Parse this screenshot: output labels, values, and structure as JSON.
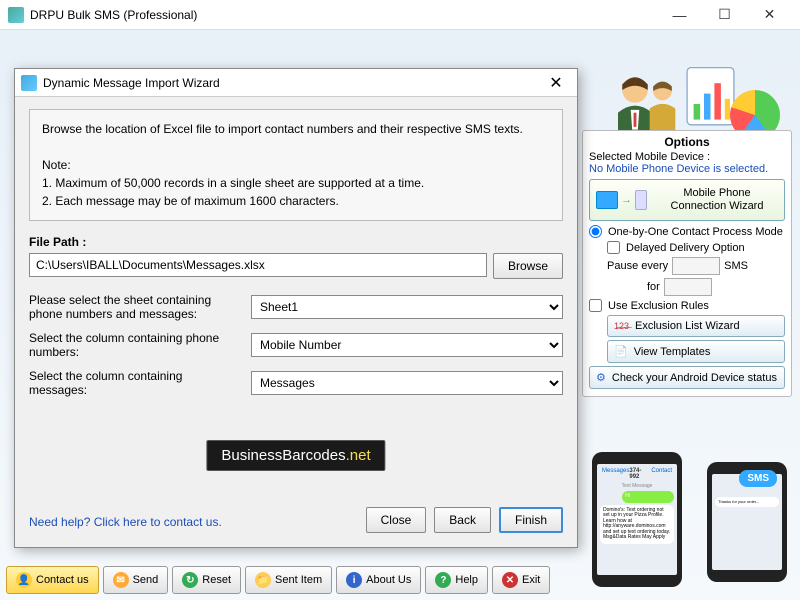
{
  "window": {
    "title": "DRPU Bulk SMS (Professional)"
  },
  "dialog": {
    "title": "Dynamic Message Import Wizard",
    "intro": "Browse the location of Excel file to import contact numbers and their respective SMS texts.",
    "note_label": "Note:",
    "note1": "1. Maximum of 50,000 records in a single sheet are supported at a time.",
    "note2": "2. Each message may be of maximum 1600 characters.",
    "file_path_label": "File Path :",
    "file_path_value": "C:\\Users\\IBALL\\Documents\\Messages.xlsx",
    "browse": "Browse",
    "sheet_label": "Please select the sheet containing phone numbers and messages:",
    "sheet_value": "Sheet1",
    "phone_col_label": "Select the column containing phone numbers:",
    "phone_col_value": "Mobile Number",
    "msg_col_label": "Select the column containing messages:",
    "msg_col_value": "Messages",
    "watermark_a": "BusinessBarcodes",
    "watermark_b": ".net",
    "help_link": "Need help? Click here to contact us.",
    "close": "Close",
    "back": "Back",
    "finish": "Finish"
  },
  "options": {
    "header": "Options",
    "selected_label": "Selected Mobile Device :",
    "no_device": "No Mobile Phone Device is selected.",
    "conn_wizard_l1": "Mobile Phone",
    "conn_wizard_l2": "Connection  Wizard",
    "one_by_one": "One-by-One Contact Process Mode",
    "delayed": "Delayed Delivery Option",
    "pause_every": "Pause every",
    "sms_suffix": "SMS",
    "for_label": "for",
    "use_exclusion": "Use Exclusion Rules",
    "exclusion_wizard": "Exclusion List Wizard",
    "view_templates": "View Templates",
    "check_android": "Check your Android Device status"
  },
  "toolbar": {
    "contact": "Contact us",
    "send": "Send",
    "reset": "Reset",
    "sent_item": "Sent Item",
    "about": "About Us",
    "help": "Help",
    "exit": "Exit"
  },
  "phone_preview": {
    "header": "Messages",
    "number": "374-992",
    "contact": "Contact",
    "msg_title": "Text Message",
    "bubble1": "Domino's: Text ordering not set up in your Pizza Profile. Learn how at http://anyware.dominos.com and set up text ordering today. Msg&Data Rates May Apply",
    "sms_badge": "SMS"
  }
}
